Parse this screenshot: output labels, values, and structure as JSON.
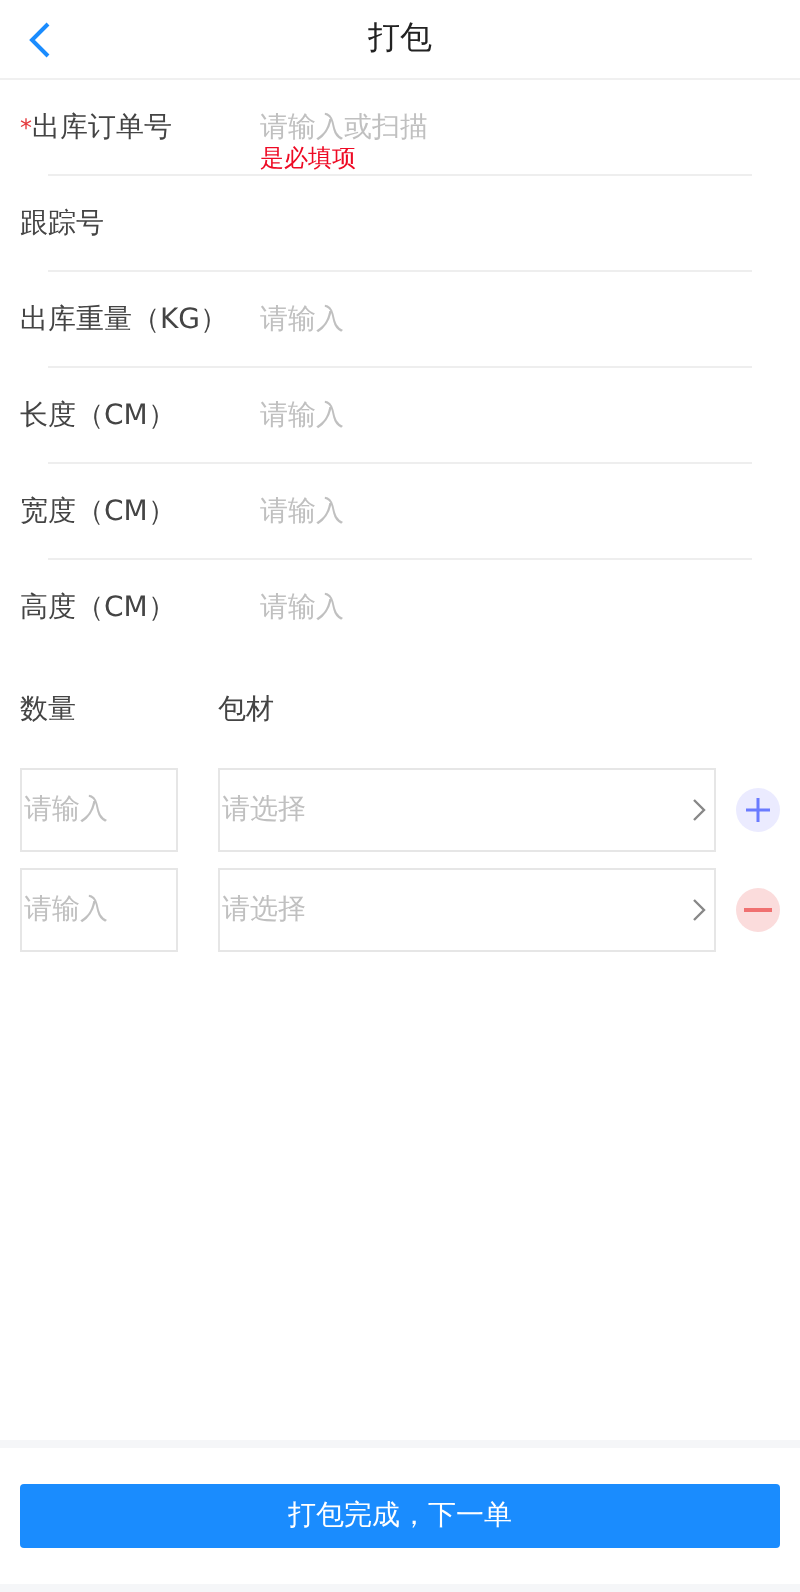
{
  "header": {
    "title": "打包"
  },
  "fields": [
    {
      "label": "出库订单号",
      "required_mark": "*",
      "placeholder": "请输入或扫描",
      "error": "是必填项"
    },
    {
      "label": "跟踪号"
    },
    {
      "label": "出库重量（KG）",
      "placeholder": "请输入"
    },
    {
      "label": "长度（CM）",
      "placeholder": "请输入"
    },
    {
      "label": "宽度（CM）",
      "placeholder": "请输入"
    },
    {
      "label": "高度（CM）",
      "placeholder": "请输入"
    }
  ],
  "packaging": {
    "columns": [
      "数量",
      "包材"
    ],
    "rows": [
      {
        "quantity_placeholder": "请输入",
        "material_placeholder": "请选择",
        "kind": "add"
      },
      {
        "quantity_placeholder": "请输入",
        "material_placeholder": "请选择",
        "kind": "remove"
      }
    ]
  },
  "submit_button": "打包完成，下一单"
}
